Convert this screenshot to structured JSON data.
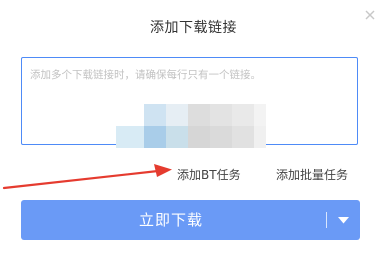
{
  "dialog": {
    "title": "添加下载链接",
    "close_icon": "close-icon",
    "url_input": {
      "value": "",
      "placeholder": "添加多个下载链接时，请确保每行只有一个链接。"
    },
    "links": {
      "add_bt": "添加BT任务",
      "add_batch": "添加批量任务"
    },
    "download_button": {
      "label": "立即下载",
      "dropdown_icon": "caret-down-icon"
    }
  },
  "colors": {
    "accent": "#4e8bf7",
    "button": "#6a9af6",
    "annotation_arrow": "#e53b2f"
  }
}
